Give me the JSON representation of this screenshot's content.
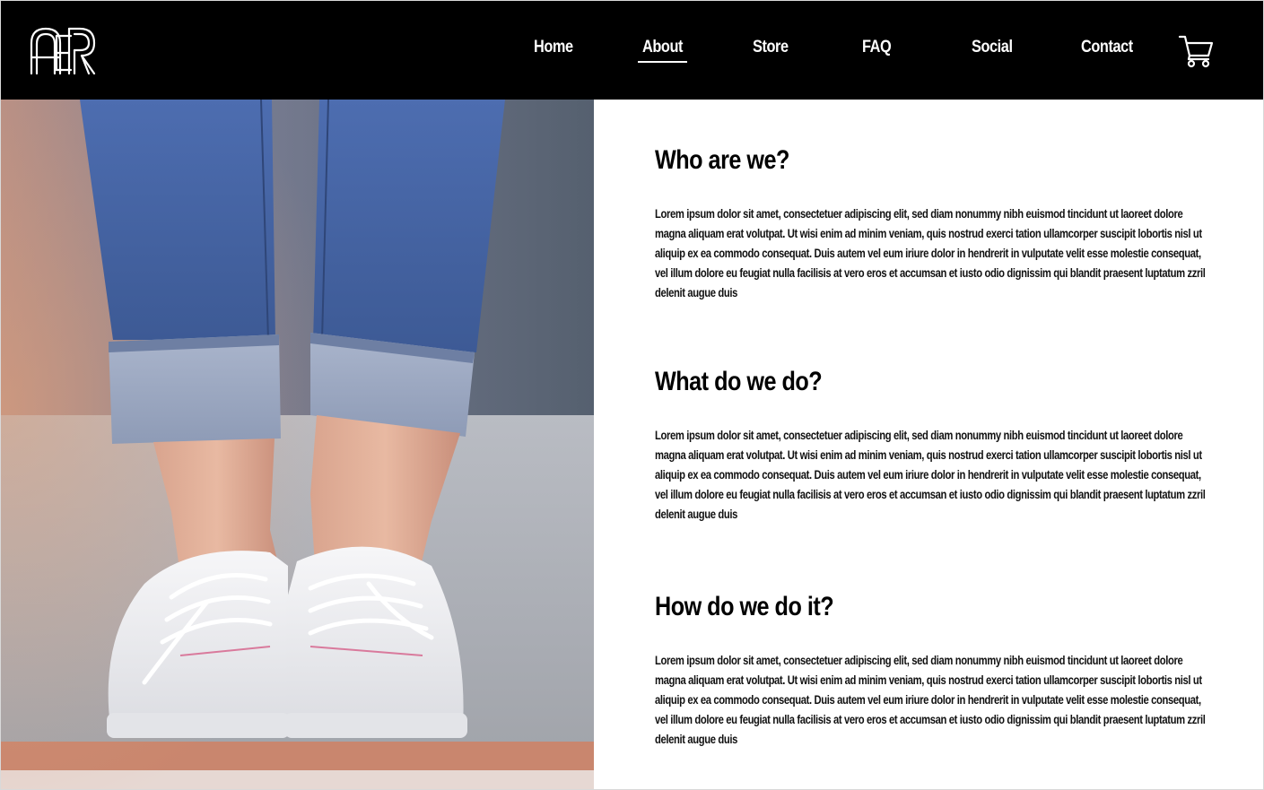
{
  "brand": {
    "logo_text": "AER",
    "logo_icon": "aer-logo"
  },
  "nav": {
    "items": [
      {
        "label": "Home"
      },
      {
        "label": "About",
        "active": true
      },
      {
        "label": "Store"
      },
      {
        "label": "FAQ"
      },
      {
        "label": "Social"
      },
      {
        "label": "Contact"
      }
    ],
    "cart_icon": "shopping-cart-icon"
  },
  "hero_image": {
    "subject": "legs in rolled-up jeans wearing white sneakers"
  },
  "sections": [
    {
      "title": "Who are we?",
      "body": "Lorem ipsum dolor sit amet, consectetuer adipiscing elit, sed diam nonummy nibh euismod tincidunt ut laoreet dolore magna aliquam erat volutpat. Ut wisi enim ad minim veniam, quis nostrud exerci tation ullamcorper suscipit lobortis nisl ut aliquip ex ea commodo consequat. Duis autem vel eum iriure dolor in hendrerit in vulputate velit esse molestie consequat, vel illum dolore eu feugiat nulla facilisis at vero eros et accumsan et iusto odio dignissim qui blandit praesent luptatum zzril delenit augue duis"
    },
    {
      "title": "What do we do?",
      "body": "Lorem ipsum dolor sit amet, consectetuer adipiscing elit, sed diam nonummy nibh euismod tincidunt ut laoreet dolore magna aliquam erat volutpat. Ut wisi enim ad minim veniam, quis nostrud exerci tation ullamcorper suscipit lobortis nisl ut aliquip ex ea commodo consequat. Duis autem vel eum iriure dolor in hendrerit in vulputate velit esse molestie consequat, vel illum dolore eu feugiat nulla facilisis at vero eros et accumsan et iusto odio dignissim qui blandit praesent luptatum zzril delenit augue duis"
    },
    {
      "title": "How do we do it?",
      "body": "Lorem ipsum dolor sit amet, consectetuer adipiscing elit, sed diam nonummy nibh euismod tincidunt ut laoreet dolore magna aliquam erat volutpat. Ut wisi enim ad minim veniam, quis nostrud exerci tation ullamcorper suscipit lobortis nisl ut aliquip ex ea commodo consequat. Duis autem vel eum iriure dolor in hendrerit in vulputate velit esse molestie consequat, vel illum dolore eu feugiat nulla facilisis at vero eros et accumsan et iusto odio dignissim qui blandit praesent luptatum zzril delenit augue duis"
    }
  ],
  "colors": {
    "header_bg": "#000000",
    "nav_text": "#ffffff",
    "page_bg": "#ffffff",
    "body_text": "#111111"
  }
}
